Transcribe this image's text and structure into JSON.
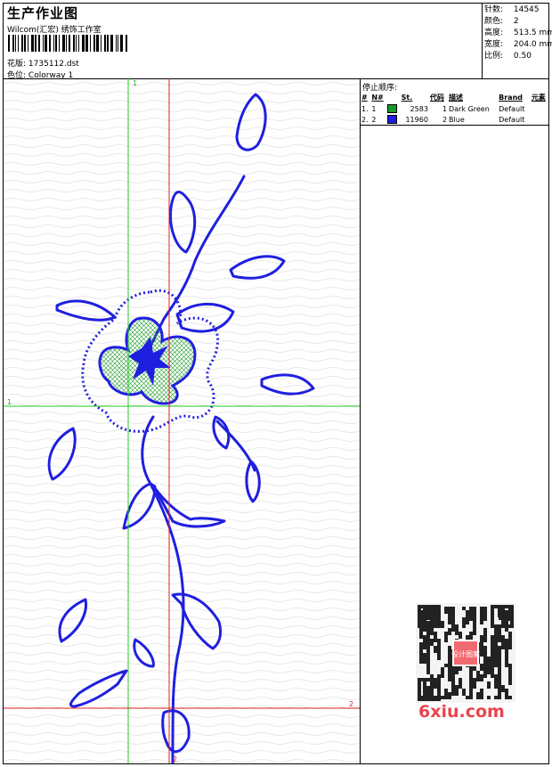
{
  "header": {
    "title": "生产作业图",
    "company": "Wilcom(汇宏) 绣饰工作室",
    "pattern_label": "花版:",
    "pattern_value": "1735112.dst",
    "colorway_label": "色位:",
    "colorway_value": "Colorway 1"
  },
  "specs": [
    {
      "label": "针数:",
      "value": "14545"
    },
    {
      "label": "颜色:",
      "value": "2"
    },
    {
      "label": "高度:",
      "value": "513.5 mm"
    },
    {
      "label": "宽度:",
      "value": "204.0 mm"
    },
    {
      "label": "比例:",
      "value": "0.50"
    }
  ],
  "stop_sequence": {
    "title": "停止顺序:",
    "columns": [
      "#",
      "N#",
      "St.",
      "代码",
      "描述",
      "Brand",
      "元素"
    ],
    "rows": [
      {
        "idx": "1.",
        "n": "1",
        "color": "#1a9a2a",
        "st": "2583",
        "code": "1",
        "desc": "Dark Green",
        "brand": "Default"
      },
      {
        "idx": "2.",
        "n": "2",
        "color": "#1f1fe0",
        "st": "11960",
        "code": "2",
        "desc": "Blue",
        "brand": "Default"
      }
    ]
  },
  "guides": {
    "green_label": "1",
    "red_label": "2"
  },
  "watermark": {
    "text": "6xiu.com",
    "qr_text": "设计图案"
  },
  "colors": {
    "stitch_blue": "#1f1fe0",
    "fill_green": "#8fd88a",
    "guide_green": "#22cc22",
    "guide_red": "#e02020"
  }
}
